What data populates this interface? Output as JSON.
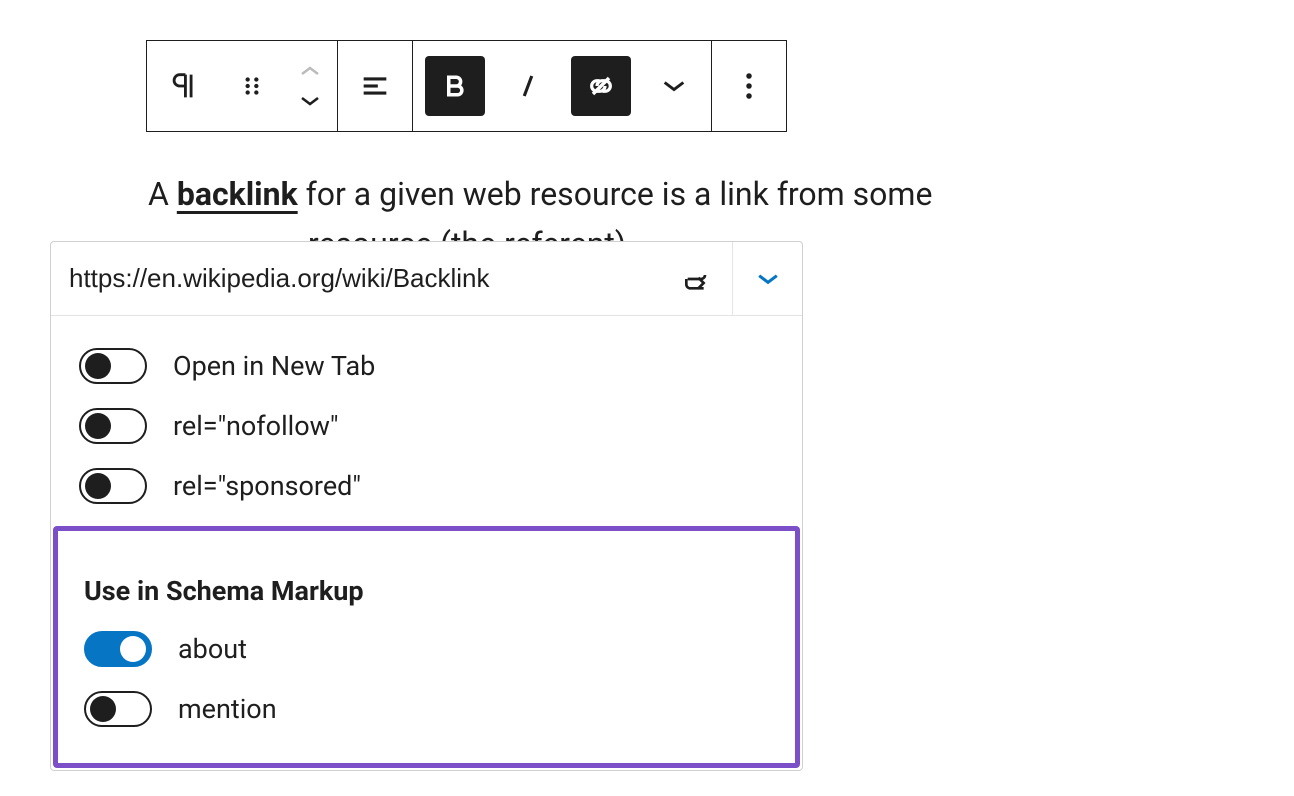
{
  "paragraph": {
    "pre": "A ",
    "link": "backlink",
    "post1": " for a given web resource is a link from some",
    "post2": " resource (the referent)."
  },
  "link_popup": {
    "url": "https://en.wikipedia.org/wiki/Backlink",
    "toggles": [
      {
        "label": "Open in New Tab",
        "on": false
      },
      {
        "label": "rel=\"nofollow\"",
        "on": false
      },
      {
        "label": "rel=\"sponsored\"",
        "on": false
      }
    ],
    "schema_section": {
      "title": "Use in Schema Markup",
      "toggles": [
        {
          "label": "about",
          "on": true
        },
        {
          "label": "mention",
          "on": false
        }
      ]
    }
  }
}
